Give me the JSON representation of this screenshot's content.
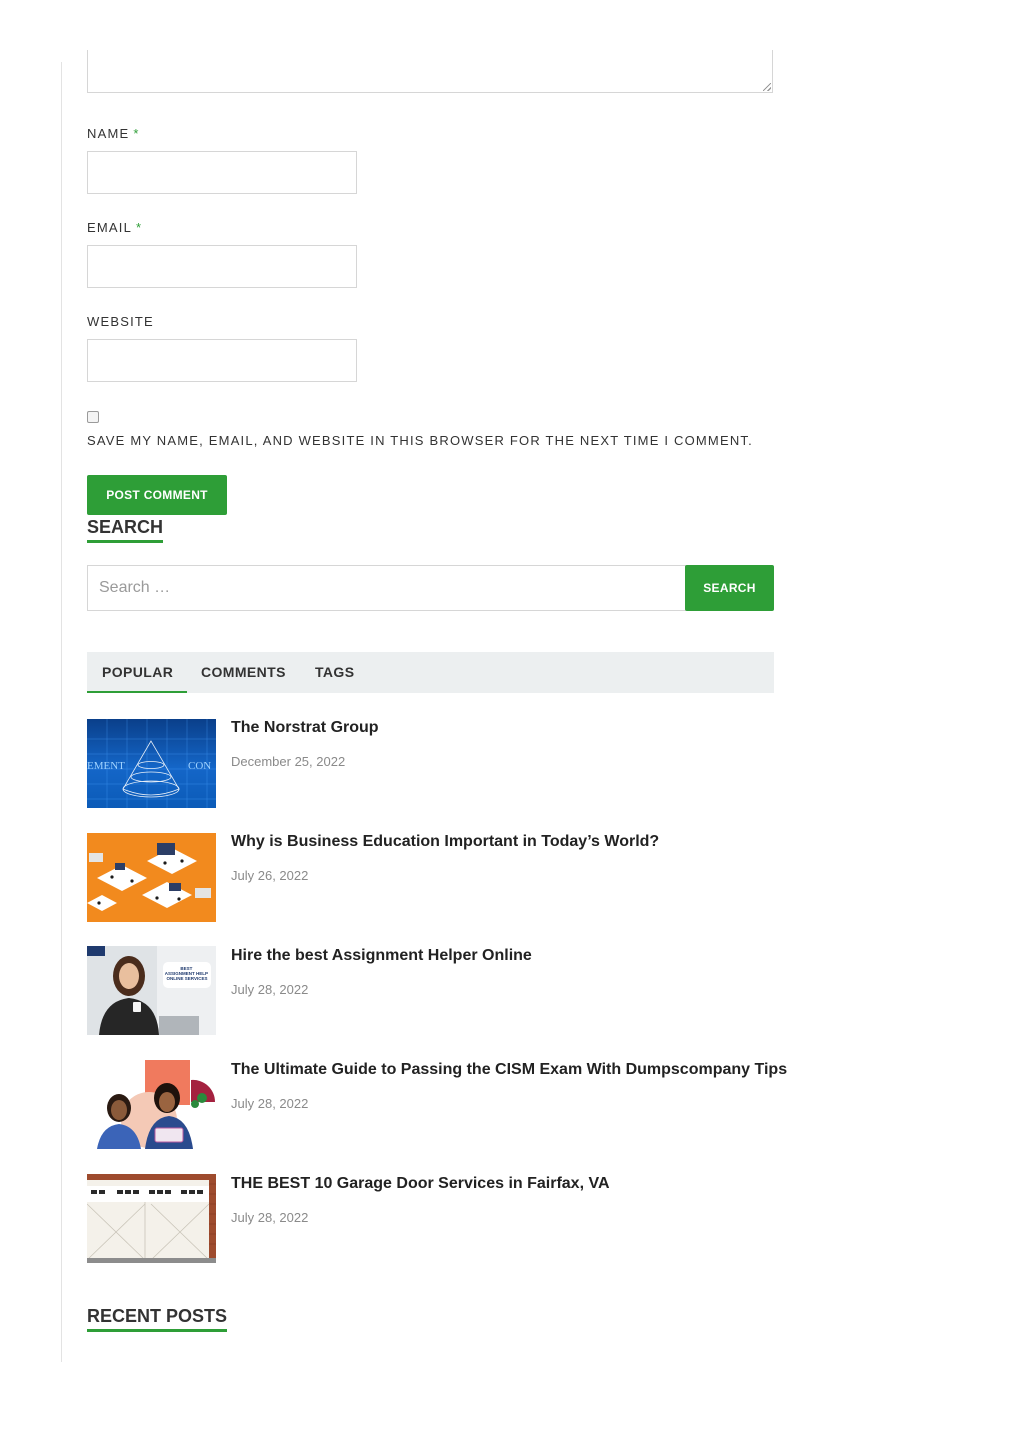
{
  "comment_form": {
    "name_label": "NAME",
    "email_label": "EMAIL",
    "website_label": "WEBSITE",
    "required_mark": "*",
    "name_value": "",
    "email_value": "",
    "website_value": "",
    "save_info_label": "SAVE MY NAME, EMAIL, AND WEBSITE IN THIS BROWSER FOR THE NEXT TIME I COMMENT.",
    "save_info_checked": false,
    "submit_label": "POST COMMENT"
  },
  "search_widget": {
    "title": "SEARCH",
    "placeholder": "Search …",
    "button_label": "SEARCH"
  },
  "tabbed_widget": {
    "tabs": [
      {
        "label": "POPULAR",
        "active": true
      },
      {
        "label": "COMMENTS",
        "active": false
      },
      {
        "label": "TAGS",
        "active": false
      }
    ],
    "posts": [
      {
        "title": "The Norstrat Group",
        "date": "December 25, 2022",
        "thumb_text_left": "EMENT",
        "thumb_text_right": "CON"
      },
      {
        "title": "Why is Business Education Important in Today’s World?",
        "date": "July 26, 2022"
      },
      {
        "title": "Hire the best Assignment Helper Online",
        "date": "July 28, 2022",
        "thumb_text": "BEST ASSIGNMENT HELP ONLINE SERVICES"
      },
      {
        "title": "The Ultimate Guide to Passing the CISM Exam With Dumpscompany Tips",
        "date": "July 28, 2022"
      },
      {
        "title": "THE BEST 10 Garage Door Services in Fairfax, VA",
        "date": "July 28, 2022"
      }
    ]
  },
  "recent_posts": {
    "title": "RECENT POSTS"
  },
  "colors": {
    "accent": "#2e9e37",
    "tab_bar": "#eceff0",
    "date_text": "#8a8a8a"
  }
}
